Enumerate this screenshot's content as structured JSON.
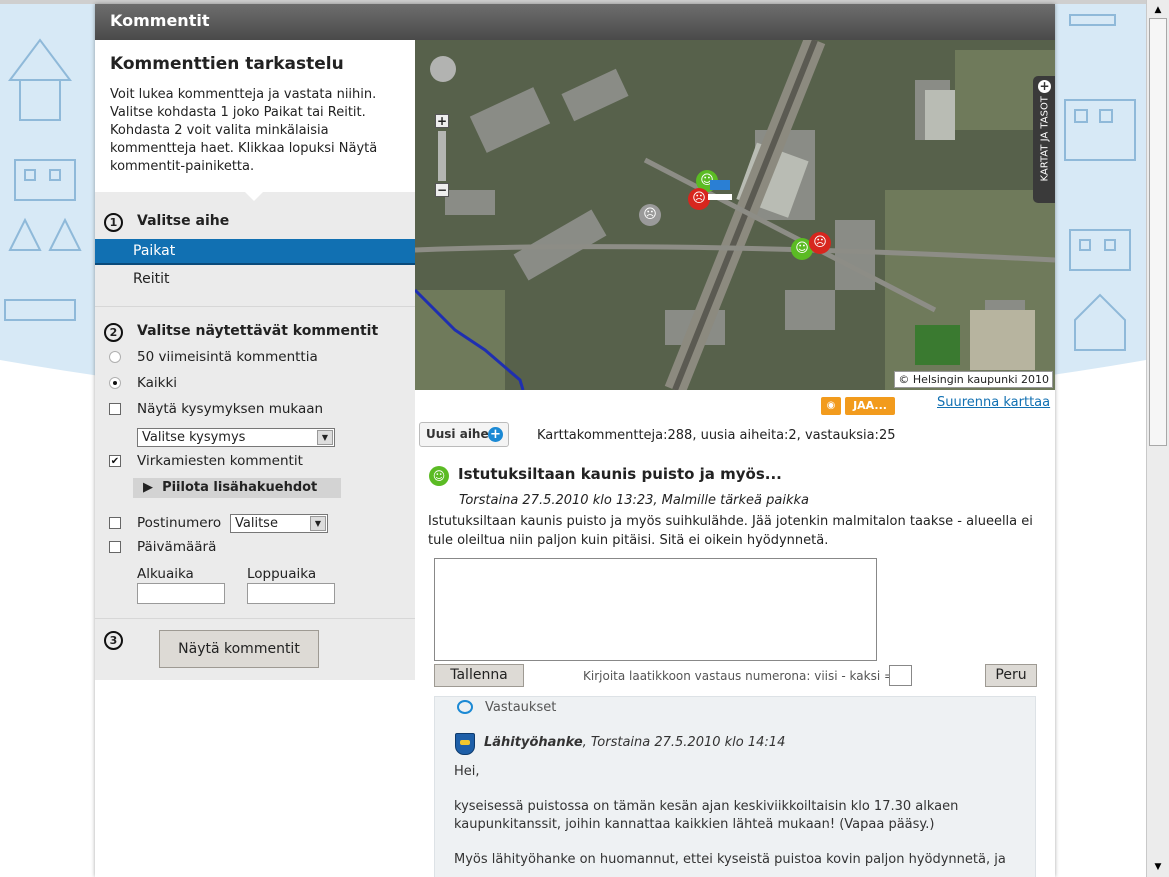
{
  "dialog": {
    "title": "Kommentit"
  },
  "sidebar": {
    "heading": "Kommenttien tarkastelu",
    "intro": "Voit lukea kommentteja ja vastata niihin. Valitse kohdasta 1 joko Paikat tai Reitit. Kohdasta 2 voit valita minkälaisia kommentteja haet. Klikkaa lopuksi Näytä kommentit-painiketta.",
    "step1": {
      "number": "1",
      "title": "Valitse aihe",
      "items": [
        {
          "label": "Paikat",
          "selected": true
        },
        {
          "label": "Reitit",
          "selected": false
        }
      ]
    },
    "step2": {
      "number": "2",
      "title": "Valitse näytettävät kommentit",
      "radio_latest": "50 viimeisintä kommenttia",
      "radio_all": "Kaikki",
      "radio_selected": "Kaikki",
      "check_by_question": "Näytä kysymyksen mukaan",
      "question_select": "Valitse kysymys",
      "check_officials": "Virkamiesten kommentit",
      "officials_checked": true,
      "toggle_more": "Piilota lisähakuehdot",
      "check_postcode": "Postinumero",
      "postcode_select": "Valitse",
      "check_date": "Päivämäärä",
      "start_label": "Alkuaika",
      "end_label": "Loppuaika"
    },
    "step3": {
      "number": "3",
      "button": "Näytä kommentit"
    }
  },
  "map": {
    "copyright": "© Helsingin kaupunki 2010",
    "layers_label": "KARTAT JA TASOT",
    "layers_plus": "+"
  },
  "toolbar": {
    "rss": "RSS",
    "share": "JAA...",
    "enlarge": "Suurenna karttaa",
    "new_topic": "Uusi aihe",
    "new_topic_plus": "+",
    "stats": "Karttakommentteja:288, uusia aiheita:2, vastauksia:25"
  },
  "comment": {
    "title": "Istutuksiltaan kaunis puisto ja myös...",
    "meta": "Torstaina 27.5.2010 klo 13:23, Malmille tärkeä paikka",
    "body": "Istutuksiltaan kaunis puisto ja myös suihkulähde. Jää jotenkin malmitalon taakse - alueella ei tule oleiltua niin paljon kuin pitäisi. Sitä ei oikein hyödynnetä.",
    "reply_value": "",
    "save_button": "Tallenna",
    "captcha_label": "Kirjoita laatikkoon vastaus numerona: viisi - kaksi =",
    "cancel_button": "Peru"
  },
  "answers": {
    "title": "Vastaukset",
    "author": "Lähityöhanke",
    "date": ", Torstaina 27.5.2010 klo 14:14",
    "p1": "Hei,",
    "p2": "kyseisessä puistossa on tämän kesän ajan keskiviikkoiltaisin klo 17.30 alkaen kaupunkitanssit, joihin kannattaa kaikkien lähteä mukaan! (Vapaa pääsy.)",
    "p3": "Myös lähityöhanke on huomannut, ettei kyseistä puistoa kovin paljon hyödynnetä, ja"
  },
  "colors": {
    "accent": "#1170b2",
    "titlebar": "#555555",
    "positive": "#5bbb24",
    "negative": "#d7261e",
    "rss": "#f29b1d"
  }
}
